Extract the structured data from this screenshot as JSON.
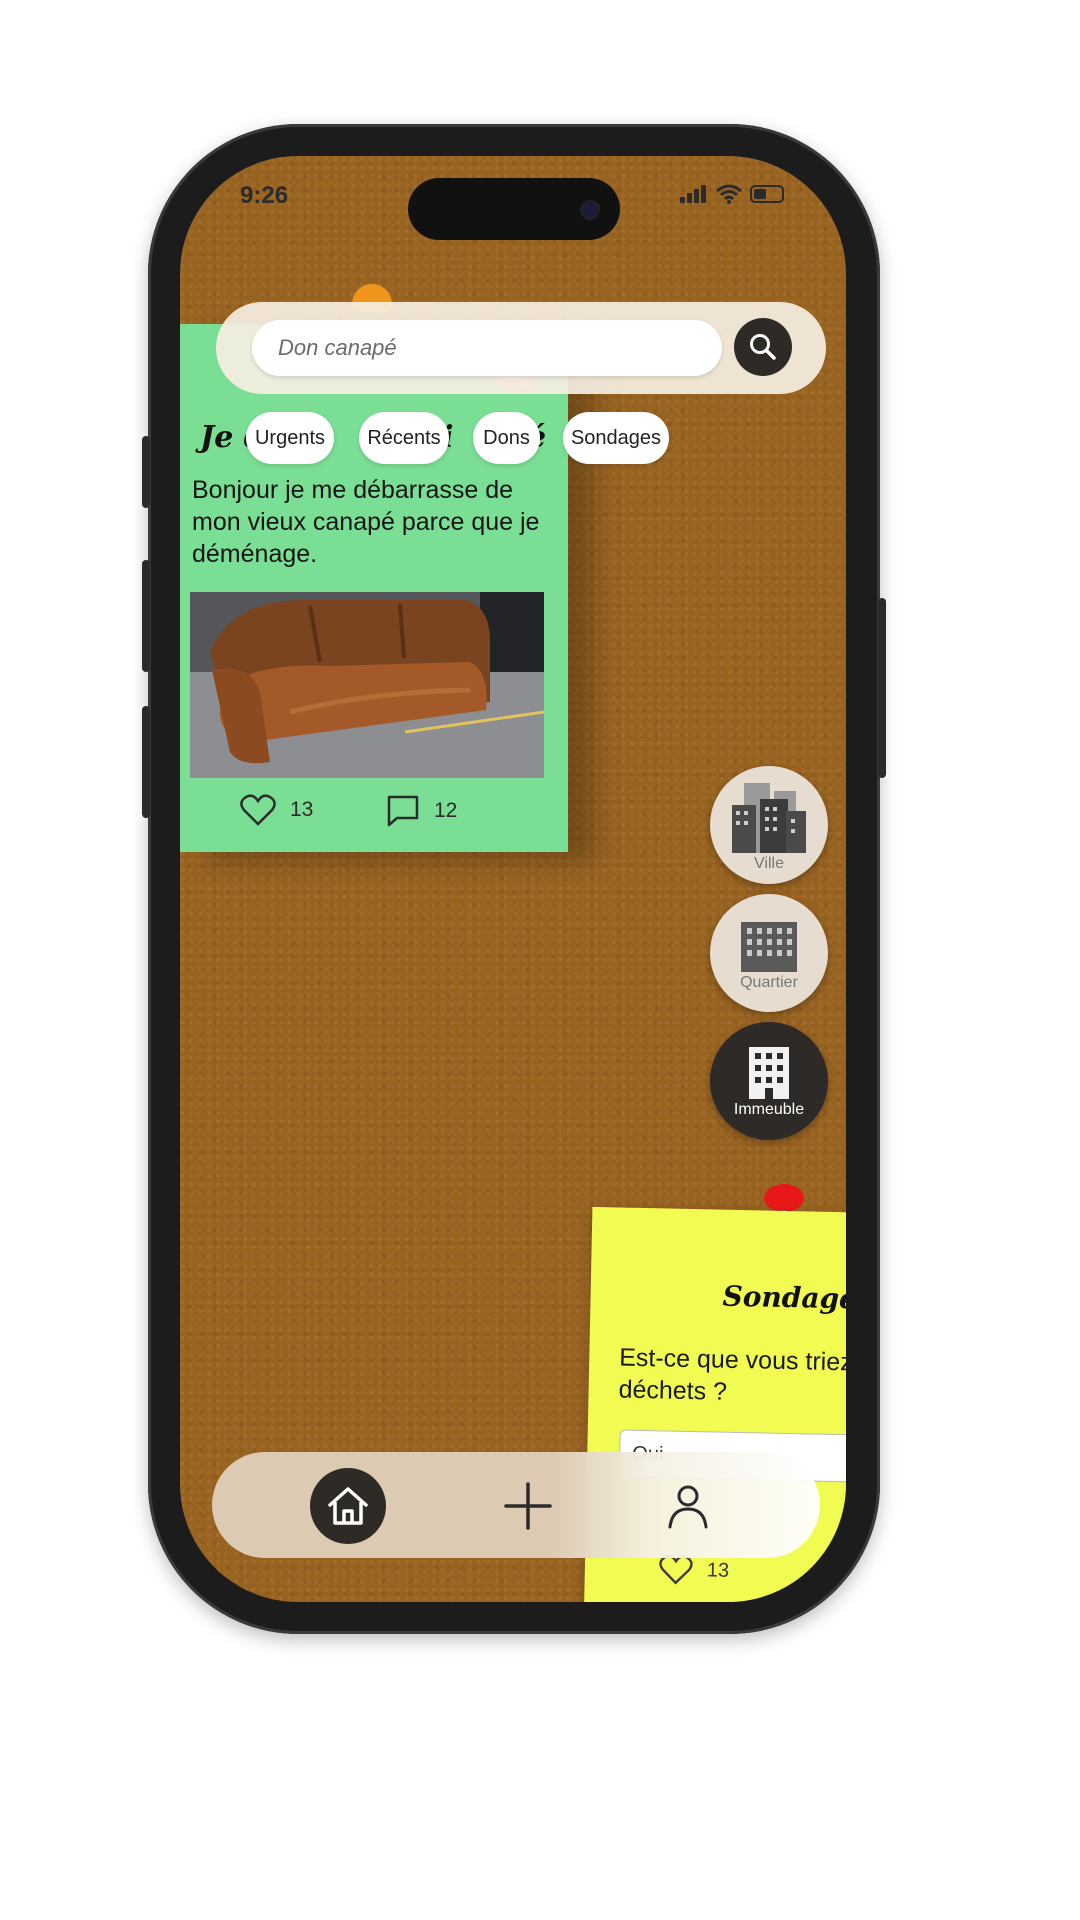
{
  "status_bar": {
    "time": "9:26"
  },
  "search": {
    "placeholder": "Don canapé"
  },
  "filters": [
    "Urgents",
    "Récents",
    "Dons",
    "Sondages"
  ],
  "post": {
    "title_start": "Je d",
    "title_mid": "vi",
    "title_end": "pé",
    "body": "Bonjour je me débarrasse de mon vieux canapé parce que je déménage.",
    "likes": "13",
    "comments": "12"
  },
  "scopes": [
    {
      "label": "Ville",
      "icon": "city-buildings-icon",
      "active": false
    },
    {
      "label": "Quartier",
      "icon": "district-building-icon",
      "active": false
    },
    {
      "label": "Immeuble",
      "icon": "apartment-building-icon",
      "active": true
    }
  ],
  "poll": {
    "title": "Sondage !",
    "question": "Est-ce que vous triez vos déchets ?",
    "option": "Oui",
    "likes": "13"
  },
  "colors": {
    "board": "#98621f",
    "green_note": "#7ade94",
    "yellow_note": "#f1fb51",
    "dark_accent": "#2e2a26"
  }
}
